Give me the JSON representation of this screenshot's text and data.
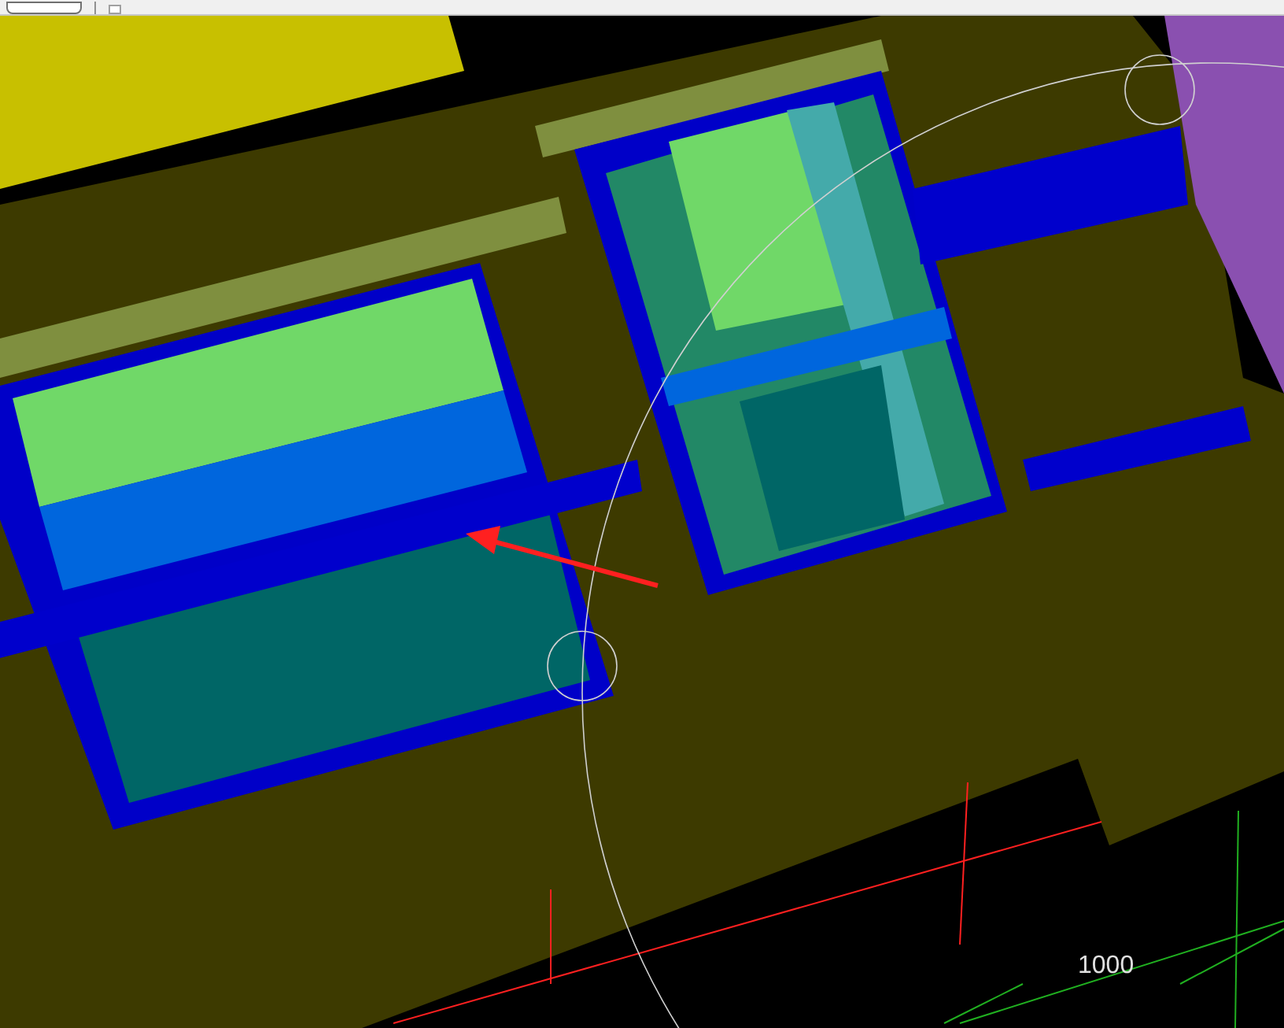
{
  "viewport": {
    "grid_label": "1000"
  }
}
